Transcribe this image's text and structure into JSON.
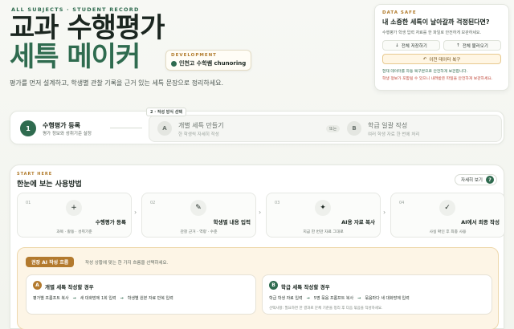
{
  "hero": {
    "eyebrow": "ALL SUBJECTS · STUDENT RECORD",
    "title_line1": "교과 수행평가",
    "title_line2": "세특 메이커",
    "subtitle": "평가를 먼저 설계하고, 학생별 관찰 기록을 근거 있는 세특 문장으로 정리하세요.",
    "dev_label": "DEVELOPMENT",
    "dev_value": "인천고 수학쌤 chunoring"
  },
  "data_safe": {
    "tag": "DATA SAFE",
    "heading": "내 소중한 세특이 날아갈까 걱정된다면?",
    "description": "수행평가 학생 입력 자료를 한 파일로 안전하게 보관하세요.",
    "save_label": "전체 저장하기",
    "load_label": "전체 불러오기",
    "restore_label": "이전 데이터 복구",
    "note_green": "현재 데이터를 자동 복구본으로 안전하게 보관합니다.",
    "note_red": "학생 정보가 포함될 수 있으니 내려받은 파일을 안전하게 보관하세요."
  },
  "process": {
    "step1": {
      "num": "1",
      "title": "수행평가 등록",
      "sub": "평가 정보와 성취기준 설정"
    },
    "choice_label": "2 · 작성 방식 선택",
    "option_a": {
      "num": "A",
      "title": "개별 세특 만들기",
      "sub": "한 학생씩 자세히 작성"
    },
    "or_label": "또는",
    "option_b": {
      "num": "B",
      "title": "학급 일괄 작성",
      "sub": "여러 학생 자료 한 번에 처리"
    }
  },
  "usage": {
    "tag": "START HERE",
    "heading": "한눈에 보는 사용방법",
    "detail_button": "자세히 보기",
    "detail_icon": "?",
    "cards": [
      {
        "num": "01",
        "icon": "+",
        "title": "수행평가 등록",
        "sub": "과목 · 활동 · 성취기준"
      },
      {
        "num": "02",
        "icon": "✎",
        "title": "학생별 내용 입력",
        "sub": "관찰 근거 · 역량 · 수준"
      },
      {
        "num": "03",
        "icon": "✦",
        "title": "AI용 자료 복사",
        "sub": "지금 한 번만 자료 그대로"
      },
      {
        "num": "04",
        "icon": "✓",
        "title": "AI에서 최종 작성",
        "sub": "사실 확인 후 최종 사용"
      }
    ],
    "flow": {
      "pill": "권장 AI 작성 흐름",
      "description": "작성 상황에 맞는 한 가지 흐름을 선택하세요.",
      "case_a": {
        "badge": "A",
        "title": "개별 세특 작성할 경우",
        "steps": [
          "평가별 프롬프트 복사",
          "새 대화방에 1회 입력",
          "학생별 원본 자료 반복 입력"
        ]
      },
      "case_b": {
        "badge": "B",
        "title": "학급 세특 작성할 경우",
        "steps": [
          "학급 학생 자료 입력",
          "5명 묶음 프롬프트 복사",
          "묶음마다 새 대화방에 입력"
        ],
        "note": "선택사항: 필요하면 한 결과로 문체 기준을 정리 후 다음 묶음을 작성하세요."
      }
    }
  },
  "colors": {
    "accent": "#2f6b4f",
    "gold": "#b37a2e",
    "warning": "#c0483a"
  }
}
